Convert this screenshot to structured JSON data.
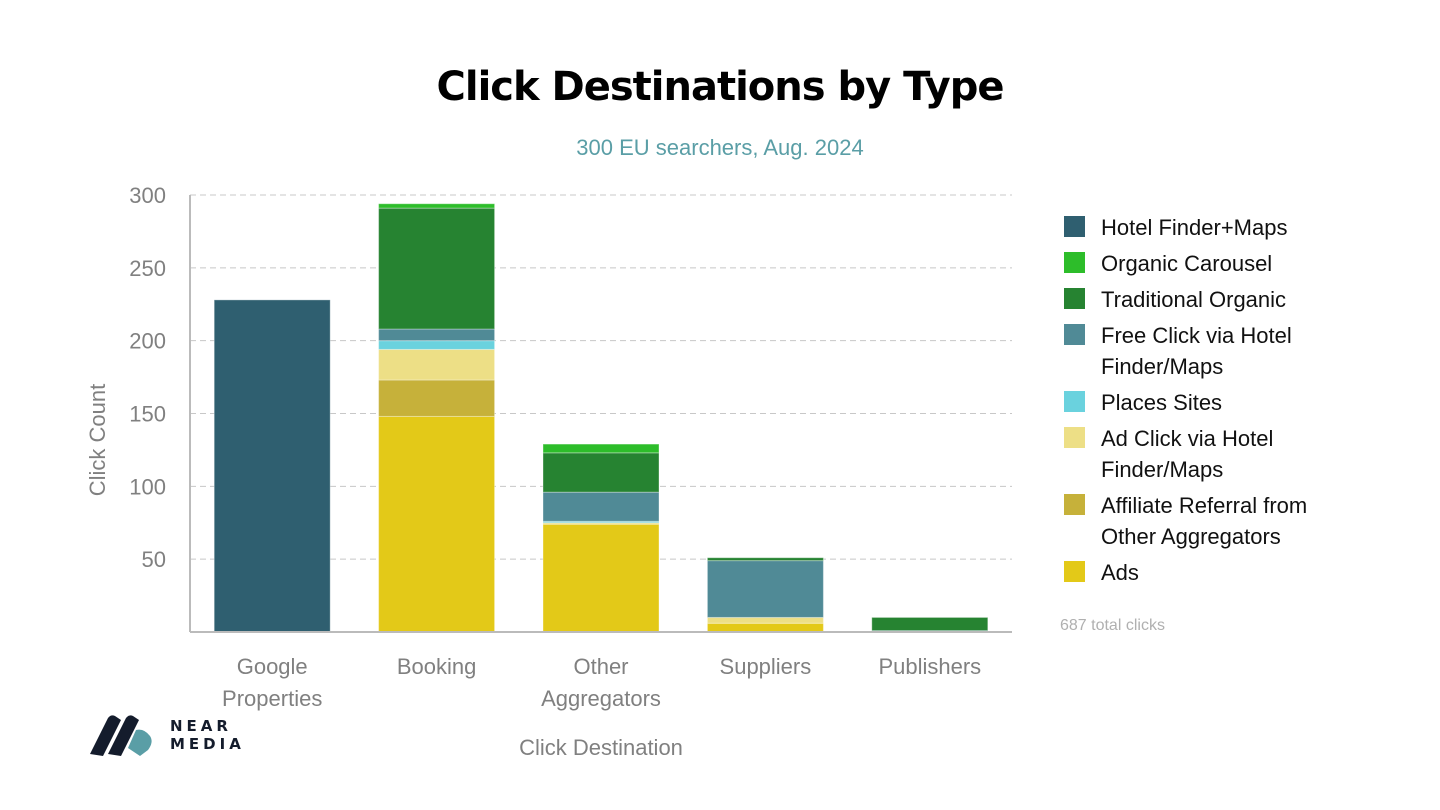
{
  "chart_data": {
    "type": "bar",
    "stacked": true,
    "title": "Click Destinations by Type",
    "subtitle": "300 EU searchers, Aug. 2024",
    "xlabel": "Click Destination",
    "ylabel": "Click Count",
    "ylim": [
      0,
      300
    ],
    "yticks": [
      50,
      100,
      150,
      200,
      250,
      300
    ],
    "grid": true,
    "legend_position": "right",
    "categories": [
      "Google\nProperties",
      "Booking",
      "Other\nAggregators",
      "Suppliers",
      "Publishers"
    ],
    "series": [
      {
        "name": "Ads",
        "color": "#e3c918",
        "values": [
          0,
          148,
          74,
          6,
          0
        ]
      },
      {
        "name": "Affiliate Referral from Other Aggregators",
        "color": "#c6b13a",
        "values": [
          0,
          25,
          0,
          0,
          0
        ]
      },
      {
        "name": "Ad Click via Hotel Finder/Maps",
        "color": "#eddf86",
        "values": [
          0,
          21,
          1,
          4,
          0
        ]
      },
      {
        "name": "Places Sites",
        "color": "#6ad2de",
        "values": [
          0,
          6,
          1,
          0,
          0
        ]
      },
      {
        "name": "Free Click via Hotel Finder/Maps",
        "color": "#508a96",
        "values": [
          0,
          8,
          20,
          39,
          1
        ]
      },
      {
        "name": "Traditional Organic",
        "color": "#268331",
        "values": [
          0,
          83,
          27,
          2,
          9
        ]
      },
      {
        "name": "Organic Carousel",
        "color": "#2dbd2a",
        "values": [
          0,
          3,
          6,
          0,
          0
        ]
      },
      {
        "name": "Hotel Finder+Maps",
        "color": "#2f5f70",
        "values": [
          228,
          0,
          0,
          0,
          0
        ]
      }
    ],
    "legend_order": [
      "Hotel Finder+Maps",
      "Organic Carousel",
      "Traditional Organic",
      "Free Click via Hotel Finder/Maps",
      "Places Sites",
      "Ad Click via Hotel Finder/Maps",
      "Affiliate Referral from Other Aggregators",
      "Ads"
    ],
    "legend_labels": [
      "Hotel Finder+Maps",
      "Organic Carousel",
      "Traditional Organic",
      "Free Click via Hotel\nFinder/Maps",
      "Places Sites",
      "Ad Click via Hotel\nFinder/Maps",
      "Affiliate Referral from\nOther Aggregators",
      "Ads"
    ],
    "annotation": "687 total clicks"
  },
  "brand": {
    "line1": "NEAR",
    "line2": "MEDIA"
  }
}
